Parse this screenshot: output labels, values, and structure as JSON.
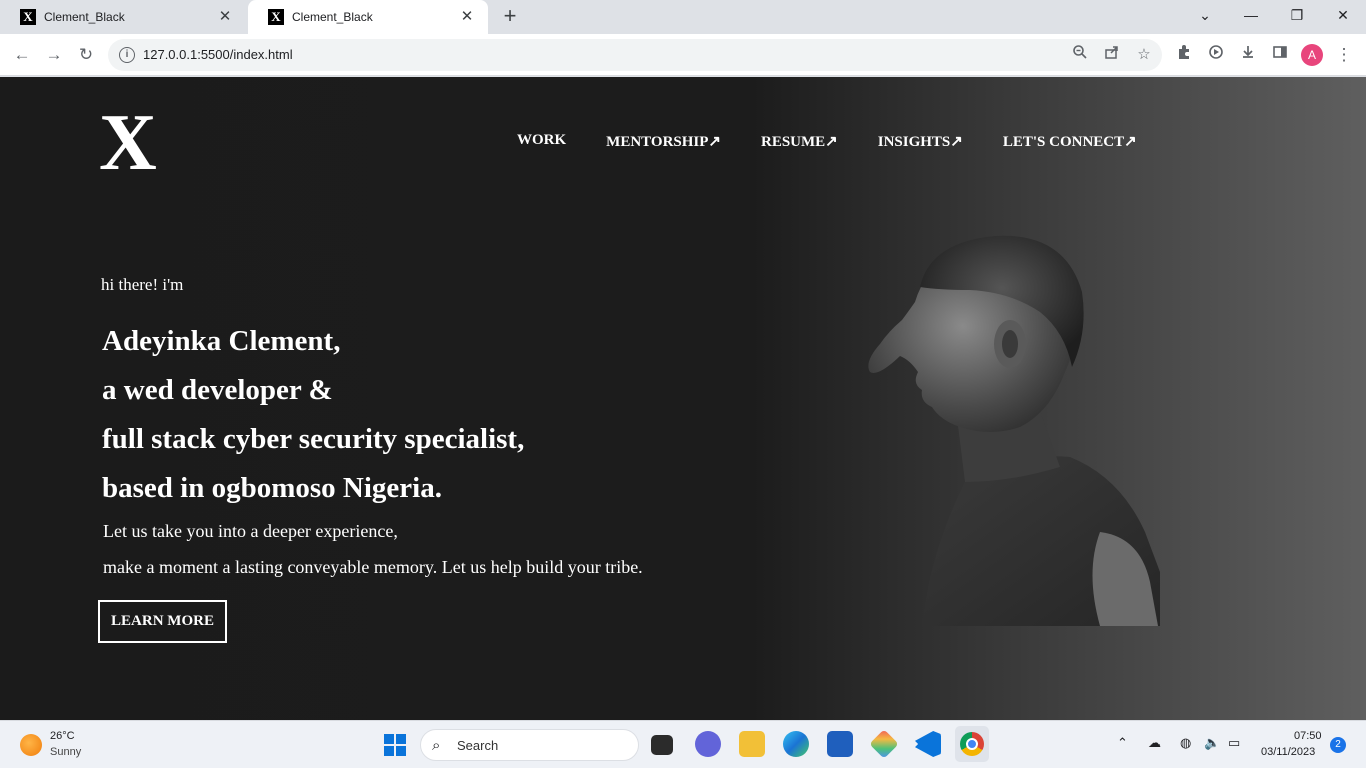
{
  "browser": {
    "tabs": [
      {
        "favicon": "X",
        "title": "Clement_Black",
        "close": "✕"
      },
      {
        "favicon": "X",
        "title": "Clement_Black",
        "close": "✕"
      }
    ],
    "new_tab": "+",
    "window_controls": {
      "tab_search": "⌄",
      "minimize": "—",
      "restore": "❐",
      "close": "✕"
    },
    "nav_buttons": {
      "back": "←",
      "forward": "→",
      "reload": "↻"
    },
    "address": "127.0.0.1:5500/index.html",
    "omnibox_icons": [
      "zoom-icon",
      "share-icon",
      "bookmark-star-icon"
    ],
    "toolbar_icons": [
      "extensions-icon",
      "media-icon",
      "download-icon",
      "sidepanel-icon",
      "menu-icon"
    ],
    "profile_initial": "A"
  },
  "page": {
    "logo": "X",
    "nav": [
      "WORK",
      "MENTORSHIP↗",
      "RESUME↗",
      "INSIGHTS↗",
      "LET'S CONNECT↗"
    ],
    "greeting": "hi there! i'm",
    "headline": [
      "Adeyinka Clement,",
      "a wed developer &",
      "full stack cyber security specialist,",
      "based in ogbomoso Nigeria."
    ],
    "subtext": [
      "Let us take you into a deeper experience,",
      "make a moment a lasting conveyable memory. Let us help build your tribe."
    ],
    "cta": "LEARN MORE",
    "colors": {
      "background": "#1b1b1b",
      "gradient_end": "#5f5f5f",
      "text": "#ffffff"
    }
  },
  "taskbar": {
    "weather": {
      "temp": "26°C",
      "condition": "Sunny"
    },
    "search_placeholder": "Search",
    "clock": {
      "time": "07:50",
      "date": "03/11/2023"
    },
    "notification_count": "2"
  }
}
